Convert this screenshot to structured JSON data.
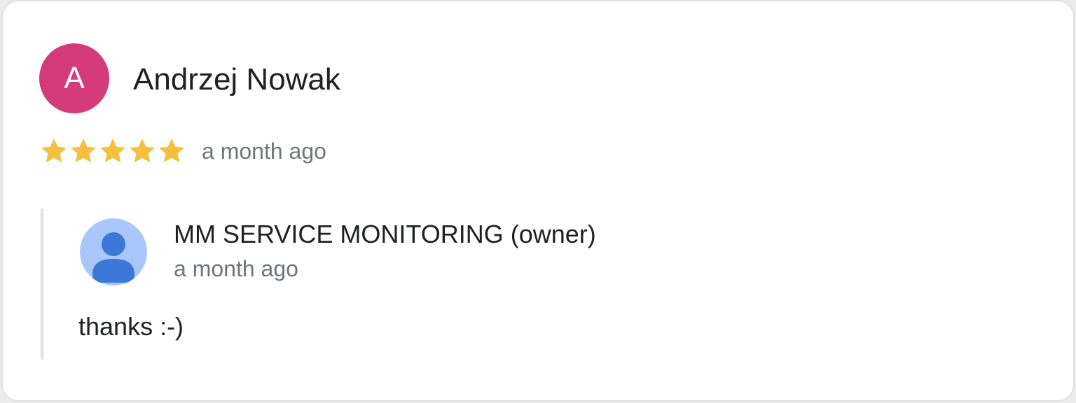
{
  "review": {
    "avatar_letter": "A",
    "avatar_color": "#d53a7a",
    "author": "Andrzej Nowak",
    "rating": 5,
    "rating_max": 5,
    "star_color": "#f4c03e",
    "time": "a month ago",
    "icons": {
      "star": "star-icon"
    }
  },
  "reply": {
    "owner_name": "MM SERVICE MONITORING (owner)",
    "time": "a month ago",
    "text": "thanks :-)",
    "avatar_bg_color": "#a9c7fa",
    "avatar_figure_color": "#3c78d8",
    "icons": {
      "avatar": "default-user-avatar-icon"
    }
  }
}
